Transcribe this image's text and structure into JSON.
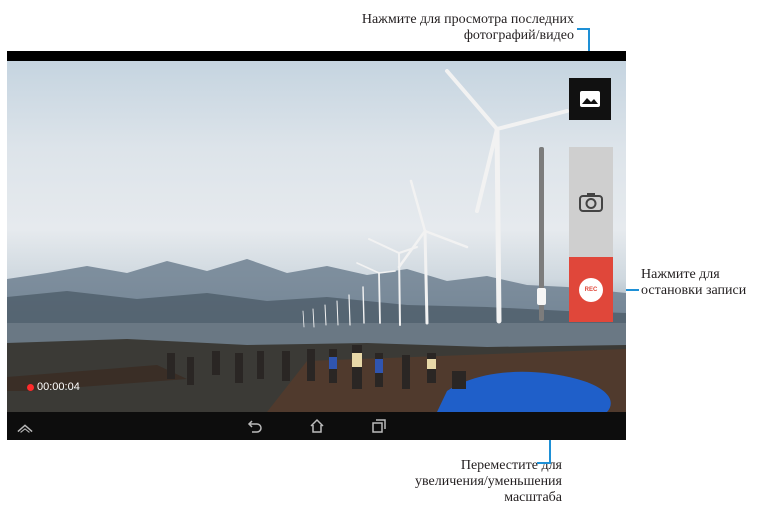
{
  "callouts": {
    "gallery": [
      "Нажмите для просмотра последних",
      "фотографий/видео"
    ],
    "stop": [
      "Нажмите для",
      "остановки записи"
    ],
    "zoom": [
      "Переместите для",
      "увеличения/уменьшения",
      "масштаба"
    ]
  },
  "camera": {
    "timer": "00:00:04",
    "rec_label": "REC",
    "zoom_level": 0.1
  },
  "icons": {
    "gallery": "image-icon",
    "shutter": "camera-icon",
    "record": "record-icon",
    "nav_home": "home-icon",
    "nav_back": "back-icon",
    "nav_recent": "recent-apps-icon",
    "nav_up": "chevron-up-icon"
  },
  "colors": {
    "callout_line": "#1e90d6",
    "rec_button": "#e0473a",
    "rec_dot": "#ff2b2b"
  }
}
